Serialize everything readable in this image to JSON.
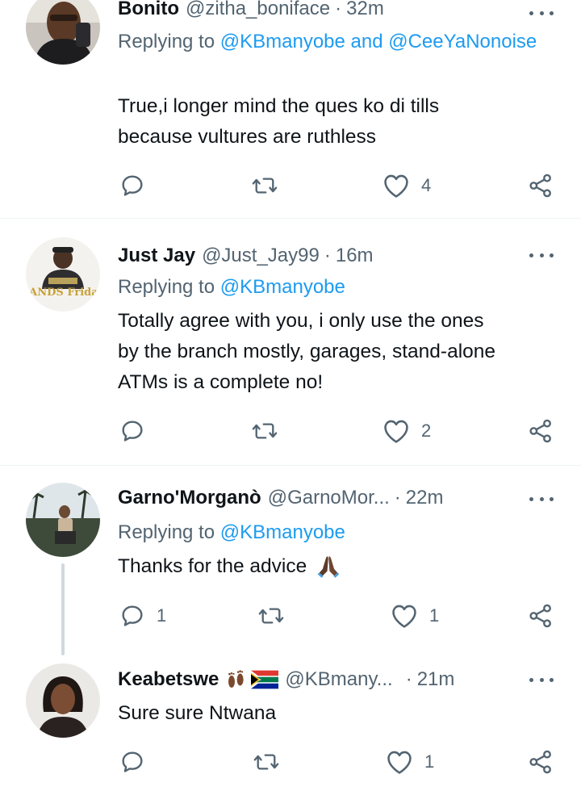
{
  "tweets": [
    {
      "name": "Bonito",
      "handle": "@zitha_boniface",
      "dot": "·",
      "time": "32m",
      "replying_prefix": "Replying to",
      "replying_mentions": "@KBmanyobe and @CeeYaNonoise",
      "body_lines": [
        "True,i longer mind the ques ko di tills",
        "because vultures are ruthless"
      ],
      "reply_count": "",
      "retweet_count": "",
      "like_count": "4"
    },
    {
      "name": "Just Jay",
      "handle": "@Just_Jay99",
      "dot": "·",
      "time": "16m",
      "replying_prefix": "Replying to",
      "replying_mentions": "@KBmanyobe",
      "body_lines": [
        "Totally agree with you, i only use the ones",
        "by the branch mostly, garages, stand-alone",
        "ATMs is a complete no!"
      ],
      "reply_count": "",
      "retweet_count": "",
      "like_count": "2",
      "avatar_text": "SANDS Friday"
    },
    {
      "name": "Garno'Morganò",
      "handle": "@GarnoMor...",
      "dot": "·",
      "time": "22m",
      "replying_prefix": "Replying to",
      "replying_mentions": "@KBmanyobe",
      "body_lines": [
        "Thanks for the advice"
      ],
      "emoji": "folded-hands",
      "reply_count": "1",
      "retweet_count": "",
      "like_count": "1"
    },
    {
      "name": "Keabetswe",
      "handle": "@KBmany...",
      "dot": "·",
      "time": "21m",
      "name_emojis": [
        "footprints",
        "south-africa-flag"
      ],
      "body_lines": [
        "Sure sure Ntwana"
      ],
      "reply_count": "",
      "retweet_count": "",
      "like_count": "1"
    }
  ],
  "icons": {
    "reply": "speech-bubble-icon",
    "retweet": "retweet-icon",
    "like": "heart-outline-icon",
    "share": "share-nodes-icon",
    "more": "more-dots-icon"
  },
  "colors": {
    "text": "#0f1419",
    "secondary": "#536471",
    "link": "#1d9bf0",
    "divider": "#eff3f4",
    "thread_line": "#cfd9de"
  }
}
